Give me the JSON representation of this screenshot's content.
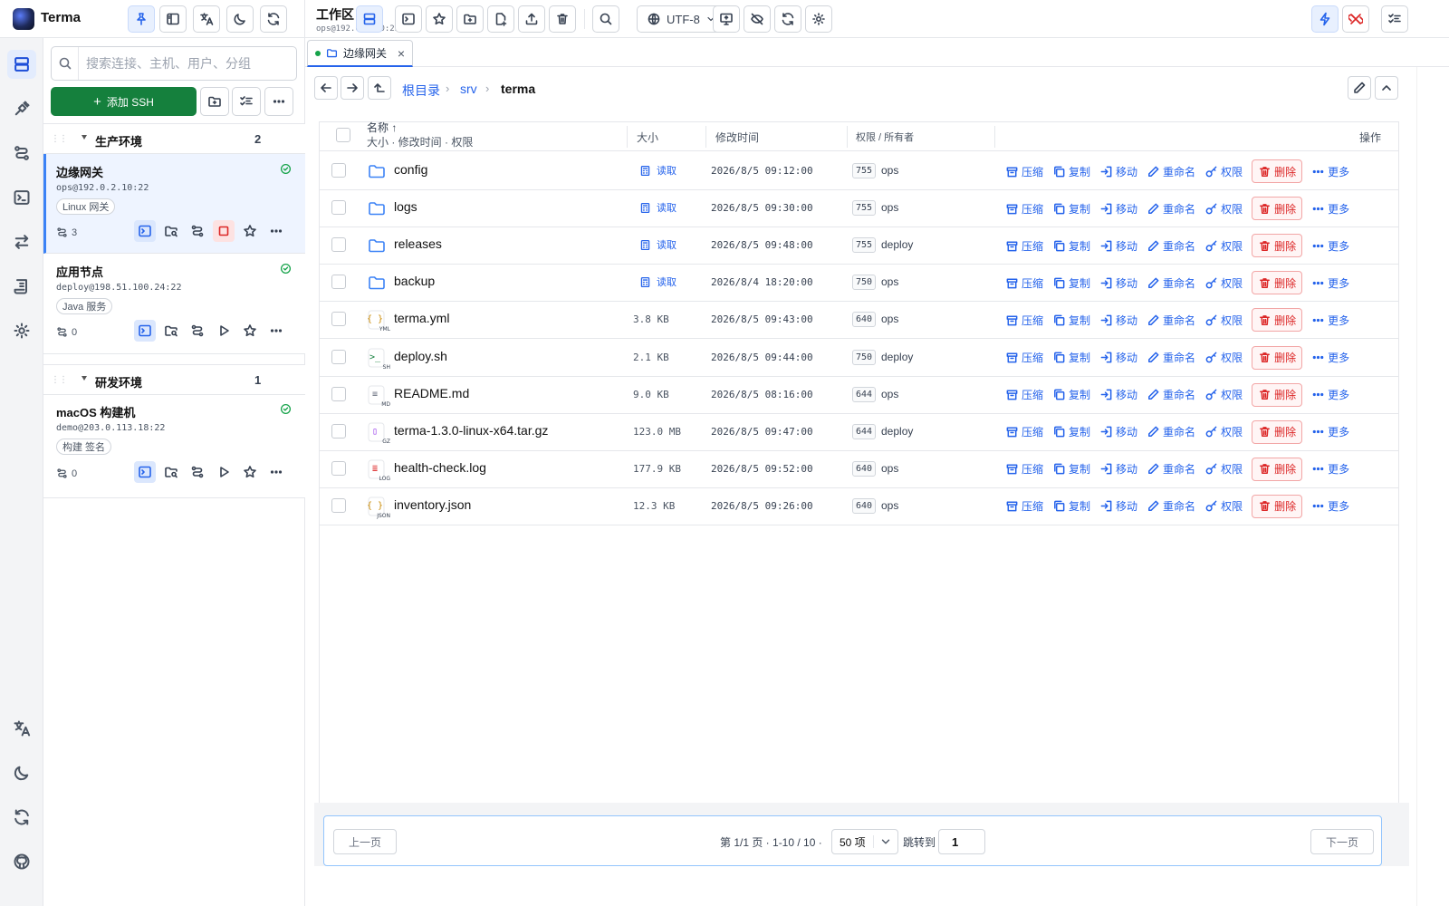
{
  "app": {
    "name": "Terma"
  },
  "header": {
    "workspace_title": "工作区",
    "workspace_sub": "ops@192.0.2.10:22",
    "encoding": "UTF-8"
  },
  "sidebar": {
    "search_placeholder": "搜索连接、主机、用户、分组",
    "add_ssh_label": "添加 SSH",
    "groups": [
      {
        "name": "生产环境",
        "count": "2",
        "hosts": [
          {
            "name": "边缘网关",
            "addr": "ops@192.0.2.10:22",
            "tag": "Linux 网关",
            "sessions": "3",
            "status": "online"
          },
          {
            "name": "应用节点",
            "addr": "deploy@198.51.100.24:22",
            "tag": "Java 服务",
            "sessions": "0",
            "status": "online"
          }
        ]
      },
      {
        "name": "研发环境",
        "count": "1",
        "hosts": [
          {
            "name": "macOS 构建机",
            "addr": "demo@203.0.113.18:22",
            "tag": "构建 签名",
            "sessions": "0",
            "status": "online"
          }
        ]
      }
    ]
  },
  "tab": {
    "label": "边缘网关"
  },
  "breadcrumb": {
    "root": "根目录",
    "items": [
      "srv",
      "terma"
    ]
  },
  "table": {
    "headers": {
      "name": "名称 ↑",
      "name_sub": "大小 · 修改时间 · 权限",
      "size": "大小",
      "mtime": "修改时间",
      "perm": "权限 / 所有者",
      "actions": "操作"
    },
    "read_label": "读取",
    "actions": [
      "压缩",
      "复制",
      "移动",
      "重命名",
      "权限",
      "删除",
      "更多"
    ],
    "rows": [
      {
        "name": "config",
        "type": "folder",
        "size": "",
        "mtime": "2026/8/5 09:12:00",
        "perm": "755",
        "owner": "ops"
      },
      {
        "name": "logs",
        "type": "folder",
        "size": "",
        "mtime": "2026/8/5 09:30:00",
        "perm": "755",
        "owner": "ops"
      },
      {
        "name": "releases",
        "type": "folder",
        "size": "",
        "mtime": "2026/8/5 09:48:00",
        "perm": "755",
        "owner": "deploy"
      },
      {
        "name": "backup",
        "type": "folder",
        "size": "",
        "mtime": "2026/8/4 18:20:00",
        "perm": "750",
        "owner": "ops"
      },
      {
        "name": "terma.yml",
        "type": "yml",
        "badge": "YML",
        "size": "3.8 KB",
        "mtime": "2026/8/5 09:43:00",
        "perm": "640",
        "owner": "ops"
      },
      {
        "name": "deploy.sh",
        "type": "sh",
        "badge": "SH",
        "size": "2.1 KB",
        "mtime": "2026/8/5 09:44:00",
        "perm": "750",
        "owner": "deploy"
      },
      {
        "name": "README.md",
        "type": "md",
        "badge": "MD",
        "size": "9.0 KB",
        "mtime": "2026/8/5 08:16:00",
        "perm": "644",
        "owner": "ops"
      },
      {
        "name": "terma-1.3.0-linux-x64.tar.gz",
        "type": "gz",
        "badge": "GZ",
        "size": "123.0 MB",
        "mtime": "2026/8/5 09:47:00",
        "perm": "644",
        "owner": "deploy"
      },
      {
        "name": "health-check.log",
        "type": "log",
        "badge": "LOG",
        "size": "177.9 KB",
        "mtime": "2026/8/5 09:52:00",
        "perm": "640",
        "owner": "ops"
      },
      {
        "name": "inventory.json",
        "type": "json",
        "badge": "JSON",
        "size": "12.3 KB",
        "mtime": "2026/8/5 09:26:00",
        "perm": "640",
        "owner": "ops"
      }
    ]
  },
  "pager": {
    "prev": "上一页",
    "next": "下一页",
    "info": "第 1/1 页 · 1-10 / 10 ·",
    "size": "50 项",
    "jump_label": "跳转到",
    "jump_value": "1"
  },
  "colors": {
    "accent": "#2563eb",
    "success": "#15803d",
    "danger": "#dc2626"
  }
}
